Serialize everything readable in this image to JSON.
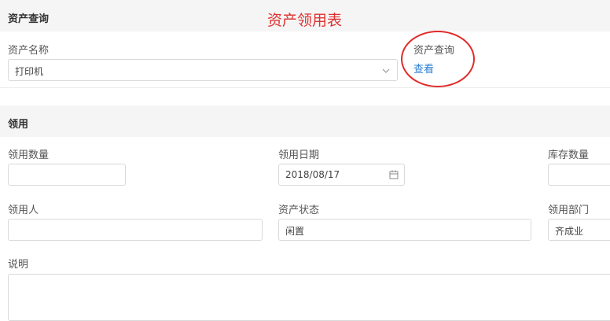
{
  "query_section": {
    "title": "资产查询",
    "annotation_title": "资产领用表",
    "asset_name_label": "资产名称",
    "asset_name_value": "打印机",
    "asset_query_label": "资产查询",
    "view_link": "查看"
  },
  "usage_section": {
    "title": "领用",
    "quantity_label": "领用数量",
    "quantity_value": "",
    "date_label": "领用日期",
    "date_value": "2018/08/17",
    "stock_label": "库存数量",
    "stock_value": "",
    "user_label": "领用人",
    "user_value": "",
    "status_label": "资产状态",
    "status_value": "闲置",
    "dept_label": "领用部门",
    "dept_value": "齐成业",
    "remark_label": "说明",
    "remark_value": ""
  },
  "colors": {
    "annotation": "#e03030",
    "link": "#2a7ed2",
    "band": "#f5f5f5"
  }
}
